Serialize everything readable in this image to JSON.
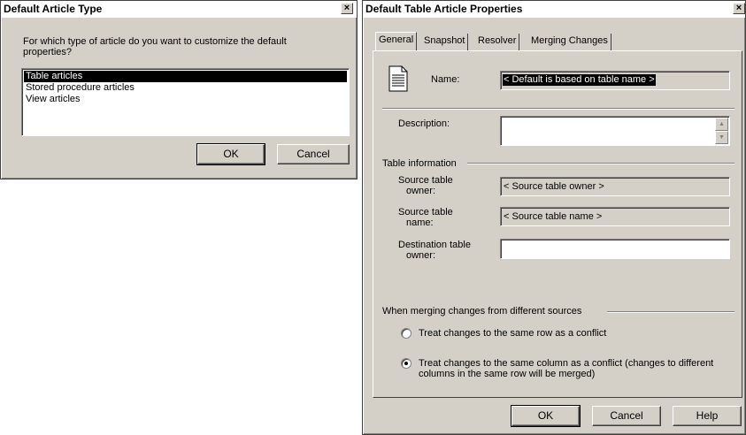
{
  "dialog1": {
    "title": "Default Article Type",
    "close": "×",
    "prompt": "For which type of article do you want to customize the default properties?",
    "list_items": [
      "Table articles",
      "Stored procedure articles",
      "View articles"
    ],
    "selected_index": 0,
    "ok_label": "OK",
    "cancel_label": "Cancel"
  },
  "dialog2": {
    "title": "Default Table Article Properties",
    "close": "×",
    "tabs": [
      "General",
      "Snapshot",
      "Resolver",
      "Merging Changes"
    ],
    "active_tab": "General",
    "name_label": "Name:",
    "name_value": "< Default is based on table name >",
    "description_label": "Description:",
    "description_value": "",
    "table_info_heading": "Table information",
    "source_owner_label": [
      "Source table",
      "owner:"
    ],
    "source_owner_value": "< Source table owner >",
    "source_name_label": [
      "Source table",
      "name:"
    ],
    "source_name_value": "< Source table name >",
    "dest_owner_label": [
      "Destination table",
      "owner:"
    ],
    "dest_owner_value": "",
    "merge_heading": "When merging changes from different sources",
    "radio_row": "Treat changes to the same row as a conflict",
    "radio_col_1": "Treat changes to the same column as a conflict (changes to different",
    "radio_col_2": "columns in the same row will be merged)",
    "selected_radio": "column",
    "ok_label": "OK",
    "cancel_label": "Cancel",
    "help_label": "Help"
  }
}
